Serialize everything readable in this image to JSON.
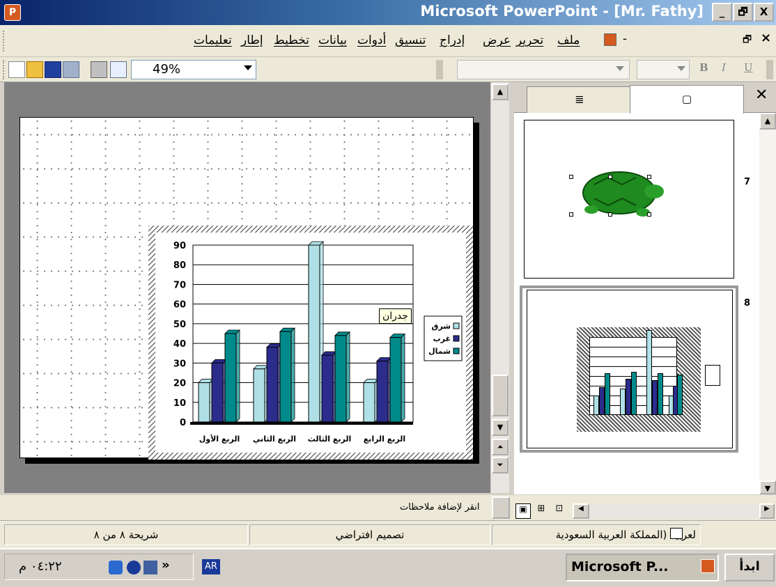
{
  "window": {
    "title": "Microsoft PowerPoint - [Mr. Fathy]",
    "minimize": "_",
    "restore": "🗗",
    "close": "X"
  },
  "menu": [
    "ملف",
    "تحرير",
    "عرض",
    "إدراج",
    "تنسيق",
    "أدوات",
    "بيانات",
    "تخطيط",
    "إطار",
    "تعليمات"
  ],
  "menu_right": {
    "close": "×",
    "restore": "🗗",
    "minus": "-"
  },
  "toolbar": {
    "zoom": "49%",
    "bold": "B",
    "italic": "I",
    "underline": "U"
  },
  "chart_data": {
    "type": "bar",
    "categories": [
      "الربع الأول",
      "الربع الثاني",
      "الربع الثالث",
      "الربع الرابع"
    ],
    "series": [
      {
        "name": "شرق",
        "color": "#aee0e6",
        "values": [
          20,
          27,
          90,
          20
        ]
      },
      {
        "name": "غرب",
        "color": "#2c2c8c",
        "values": [
          30,
          38,
          34,
          31
        ]
      },
      {
        "name": "شمال",
        "color": "#008a8a",
        "values": [
          45,
          46,
          44,
          43
        ]
      }
    ],
    "ylim": [
      0,
      90
    ],
    "yticks": [
      0,
      10,
      20,
      30,
      40,
      50,
      60,
      70,
      80,
      90
    ],
    "legend": "right",
    "grid": true,
    "tooltip": "جدران"
  },
  "panel": {
    "slide7": "7",
    "slide8": "8",
    "close": "✕"
  },
  "notes": {
    "text": "انقر لإضافة ملاحظات"
  },
  "status": {
    "slide": "شريحة ٨ من ٨",
    "design": "تصميم افتراضي",
    "lang": "لعربية (المملكة العربية السعودية"
  },
  "taskbar": {
    "start": "ابدأ",
    "app": "Microsoft P...",
    "clock": "٠٤:٢٢ م",
    "lang": "AR",
    "more": "»"
  }
}
